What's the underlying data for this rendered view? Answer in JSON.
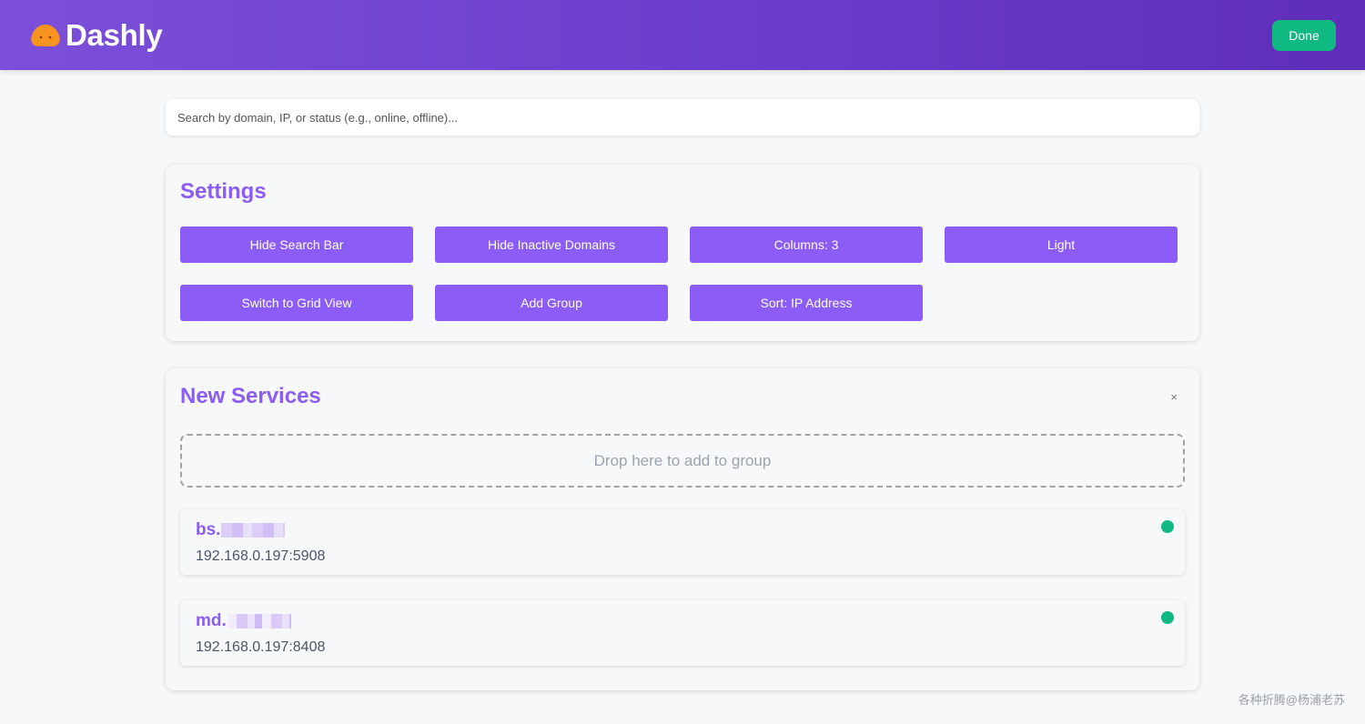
{
  "header": {
    "brand": "Dashly",
    "done_label": "Done",
    "colors": {
      "header_start": "#7b4fd9",
      "header_end": "#5f2db8",
      "done_bg": "#10b981"
    }
  },
  "search": {
    "placeholder": "Search by domain, IP, or status (e.g., online, offline)...",
    "value": ""
  },
  "settings": {
    "title": "Settings",
    "buttons": [
      {
        "label": "Hide Search Bar"
      },
      {
        "label": "Hide Inactive Domains"
      },
      {
        "label": "Columns: 3"
      },
      {
        "label": "Light"
      },
      {
        "label": "Switch to Grid View"
      },
      {
        "label": "Add Group"
      },
      {
        "label": "Sort: IP Address"
      }
    ],
    "accent": "#8b5cf6"
  },
  "group": {
    "title": "New Services",
    "close_symbol": "×",
    "dropzone_text": "Drop here to add to group",
    "services": [
      {
        "domain_prefix": "bs.",
        "ip": "192.168.0.197:5908",
        "status": "online",
        "status_color": "#10b981"
      },
      {
        "domain_prefix": "md.",
        "ip": "192.168.0.197:8408",
        "status": "online",
        "status_color": "#10b981"
      }
    ]
  },
  "watermark": "各种折腾@杨浦老苏"
}
